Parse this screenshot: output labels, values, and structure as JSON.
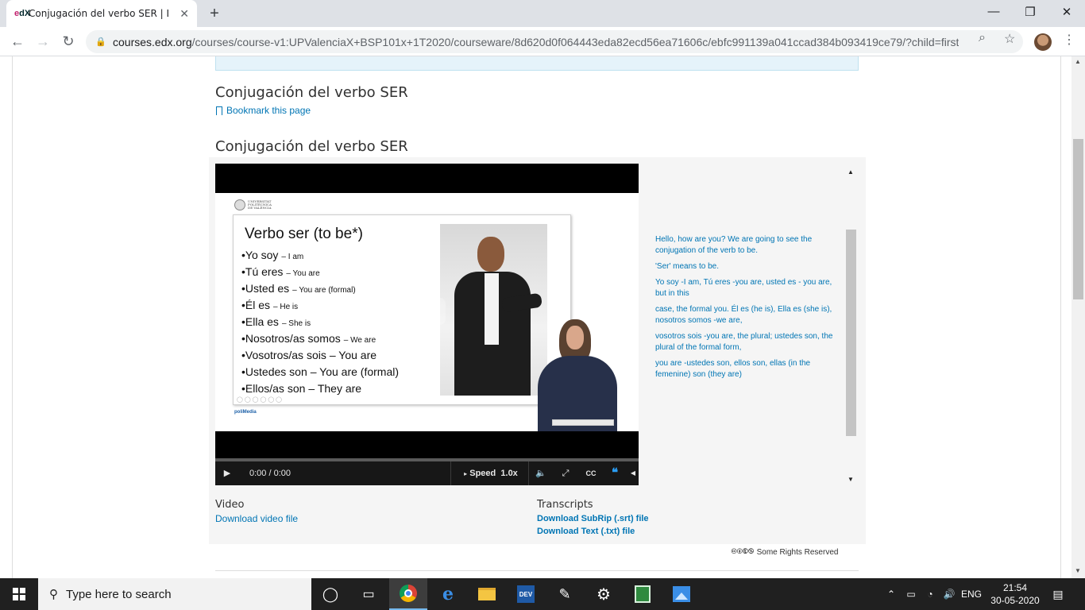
{
  "browser": {
    "tab_title": "Conjugación del verbo SER | La n",
    "tab_favicon_letters": "edX",
    "new_tab_symbol": "+",
    "close_tab_symbol": "✕",
    "window_controls": {
      "minimize": "—",
      "maximize": "❐",
      "close": "✕"
    },
    "url_host": "courses.edx.org",
    "url_path": "/courses/course-v1:UPValenciaX+BSP101x+1T2020/courseware/8d620d0f064443eda82ecd56ea71606c/ebfc991139a041ccad384b093419ce79/?child=first",
    "nav_icons": [
      "back-arrow-icon",
      "forward-arrow-icon",
      "reload-icon"
    ],
    "omnibox_icons": [
      "zoom-icon",
      "star-icon"
    ]
  },
  "page": {
    "unit_title": "Conjugación del verbo SER",
    "bookmark_label": "Bookmark this page",
    "video_heading": "Conjugación del verbo SER",
    "video": {
      "slide_title": "Verbo ser (to be*)",
      "university_name": "UNIVERSITAT POLITÈCNICA DE VALÈNCIA",
      "polimedia_label_a": "poli",
      "polimedia_label_b": "Media",
      "slide_bullets": [
        {
          "es": "Yo soy",
          "en": "– I am",
          "big": false
        },
        {
          "es": "Tú eres",
          "en": "– You are",
          "big": false
        },
        {
          "es": "Usted es",
          "en": "– You are (formal)",
          "big": false
        },
        {
          "es": "Él es",
          "en": "– He is",
          "big": false
        },
        {
          "es": "Ella es",
          "en": "– She is",
          "big": false
        },
        {
          "es": "Nosotros/as somos",
          "en": "– We are",
          "big": false
        },
        {
          "es": "Vosotros/as sois",
          "en": "– You are",
          "big": true
        },
        {
          "es": "Ustedes son",
          "en": "– You are (formal)",
          "big": true
        },
        {
          "es": "Ellos/as son",
          "en": "– They are",
          "big": true
        }
      ],
      "time": "0:00 / 0:00",
      "speed_label": "Speed",
      "speed_value": "1.0x",
      "progress_fraction": 0.0
    },
    "transcript": [
      "Hello, how are you? We are going to see the conjugation of the verb to be.",
      "'Ser' means to be.",
      "Yo soy -I am, Tú eres -you are, usted es - you are, but in this",
      "case, the formal you. Él es (he is), Ella es (she is), nosotros somos -we are,",
      "vosotros sois -you are, the plural; ustedes son, the plural of the formal form,",
      "you are -ustedes son, ellos son, ellas (in the femenine) son (they are)"
    ],
    "downloads": {
      "video_heading": "Video",
      "video_link": "Download video file",
      "transcripts_heading": "Transcripts",
      "srt_link": "Download SubRip (.srt) file",
      "txt_link": "Download Text (.txt) file"
    },
    "license_text": "Some Rights Reserved",
    "license_symbols": "🅭🅯🅮🄏"
  },
  "taskbar": {
    "search_placeholder": "Type here to search",
    "language": "ENG",
    "time": "21:54",
    "date": "30-05-2020",
    "dev_label": "DEV"
  },
  "colors": {
    "link": "#0075b4",
    "heading": "#313131",
    "taskbar": "#202020"
  }
}
